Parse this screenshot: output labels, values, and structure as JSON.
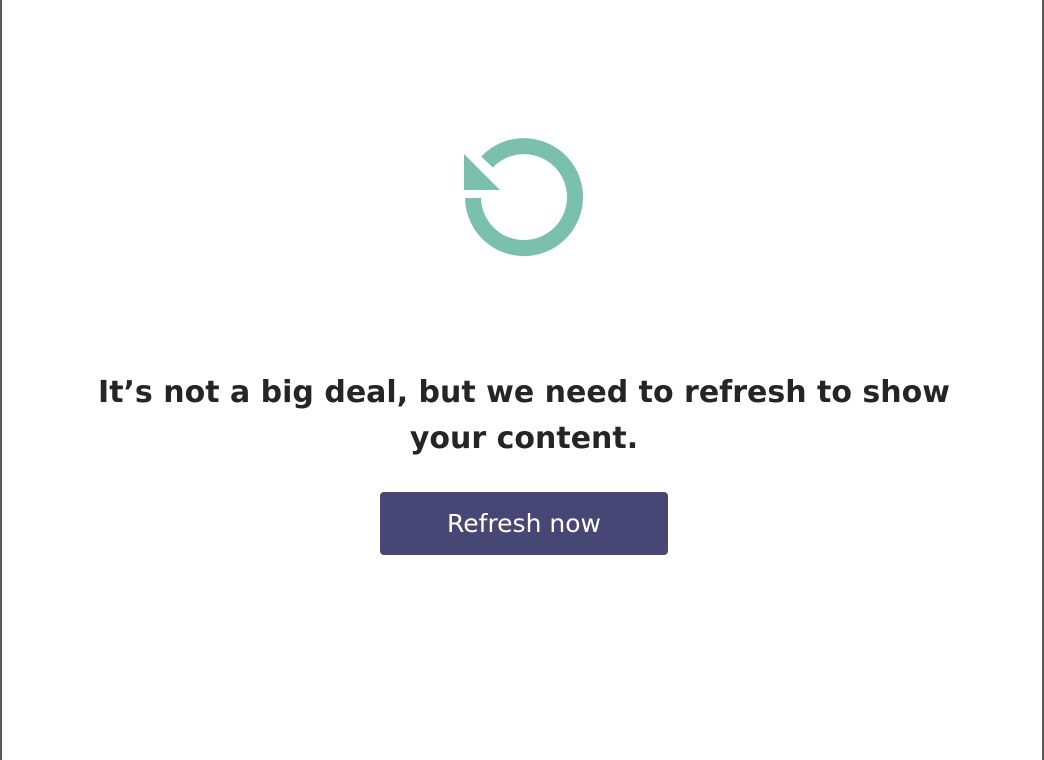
{
  "dialog": {
    "icon": "refresh-arrow-icon",
    "message": "It’s not a big deal, but we need to refresh to show your content.",
    "refresh_label": "Refresh now"
  },
  "colors": {
    "icon": "#7bbfae",
    "button_background": "#464775",
    "button_text": "#ffffff",
    "message_text": "#252525",
    "frame_border": "#5a5a5a"
  }
}
